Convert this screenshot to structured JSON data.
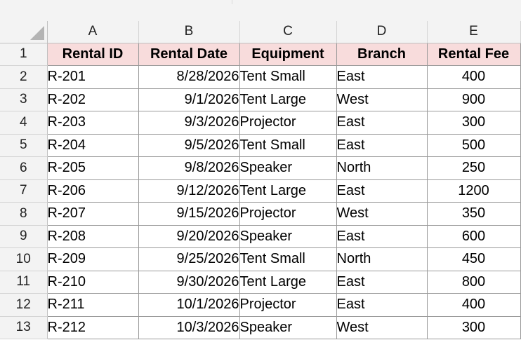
{
  "columns": [
    "A",
    "B",
    "C",
    "D",
    "E"
  ],
  "headers": [
    "Rental ID",
    "Rental Date",
    "Equipment",
    "Branch",
    "Rental Fee"
  ],
  "row_numbers": [
    "1",
    "2",
    "3",
    "4",
    "5",
    "6",
    "7",
    "8",
    "9",
    "10",
    "11",
    "12",
    "13"
  ],
  "rows": [
    [
      "R-201",
      "8/28/2026",
      "Tent Small",
      "East",
      "400"
    ],
    [
      "R-202",
      "9/1/2026",
      "Tent Large",
      "West",
      "900"
    ],
    [
      "R-203",
      "9/3/2026",
      "Projector",
      "East",
      "300"
    ],
    [
      "R-204",
      "9/5/2026",
      "Tent Small",
      "East",
      "500"
    ],
    [
      "R-205",
      "9/8/2026",
      "Speaker",
      "North",
      "250"
    ],
    [
      "R-206",
      "9/12/2026",
      "Tent Large",
      "East",
      "1200"
    ],
    [
      "R-207",
      "9/15/2026",
      "Projector",
      "West",
      "350"
    ],
    [
      "R-208",
      "9/20/2026",
      "Speaker",
      "East",
      "600"
    ],
    [
      "R-209",
      "9/25/2026",
      "Tent Small",
      "North",
      "450"
    ],
    [
      "R-210",
      "9/30/2026",
      "Tent Large",
      "East",
      "800"
    ],
    [
      "R-211",
      "10/1/2026",
      "Projector",
      "East",
      "400"
    ],
    [
      "R-212",
      "10/3/2026",
      "Speaker",
      "West",
      "300"
    ]
  ],
  "colors": {
    "header_fill": "#f8dcdc",
    "chrome_fill": "#f3f3f3",
    "gridline": "#9a9a9a"
  }
}
